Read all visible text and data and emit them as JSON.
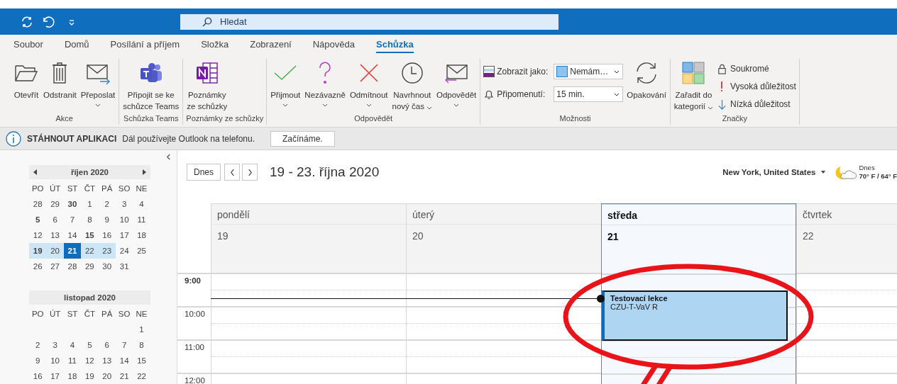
{
  "search": {
    "placeholder": "Hledat"
  },
  "tabs": [
    {
      "label": "Soubor",
      "selected": false
    },
    {
      "label": "Domů",
      "selected": false
    },
    {
      "label": "Posílání a příjem",
      "selected": false
    },
    {
      "label": "Složka",
      "selected": false
    },
    {
      "label": "Zobrazení",
      "selected": false
    },
    {
      "label": "Nápověda",
      "selected": false
    },
    {
      "label": "Schůzka",
      "selected": true
    }
  ],
  "ribbon": [
    {
      "label": "Akce",
      "items": [
        {
          "kind": "open",
          "lines": [
            "Otevřít"
          ],
          "dropdown": false
        },
        {
          "kind": "delete",
          "lines": [
            "Odstranit"
          ],
          "dropdown": false
        },
        {
          "kind": "forward",
          "lines": [
            "Přeposlat"
          ],
          "dropdown": true
        }
      ]
    },
    {
      "label": "Schůzka Teams",
      "items": [
        {
          "kind": "teams",
          "lines": [
            "Připojit se ke",
            "schůzce Teams"
          ],
          "dropdown": false
        }
      ]
    },
    {
      "label": "Poznámky ze schůzky",
      "items": [
        {
          "kind": "notes",
          "lines": [
            "Poznámky",
            "ze schůzky"
          ],
          "dropdown": false
        }
      ]
    },
    {
      "label": "Odpovědět",
      "items": [
        {
          "kind": "accept",
          "lines": [
            "Přijmout"
          ],
          "dropdown": true
        },
        {
          "kind": "tentative",
          "lines": [
            "Nezávazně"
          ],
          "dropdown": true
        },
        {
          "kind": "decline",
          "lines": [
            "Odmítnout"
          ],
          "dropdown": true
        },
        {
          "kind": "propose",
          "lines": [
            "Navrhnout",
            "nový čas"
          ],
          "dropdown": true
        },
        {
          "kind": "respond",
          "lines": [
            "Odpovědět"
          ],
          "dropdown": true
        }
      ]
    },
    {
      "label": "Možnosti",
      "items": [
        {
          "kind": "showas",
          "label": "Zobrazit jako:",
          "value": "Nemám…"
        },
        {
          "kind": "reminder",
          "label": "Připomenutí:",
          "value": "15 min."
        },
        {
          "kind": "recurrence",
          "lines": [
            "Opakování"
          ],
          "dropdown": false
        }
      ]
    },
    {
      "label": "Značky",
      "items": [
        {
          "kind": "categorize",
          "lines": [
            "Zařadit do",
            "kategorií"
          ],
          "dropdown": true
        },
        {
          "kind": "private",
          "label": "Soukromé"
        },
        {
          "kind": "high",
          "label": "Vysoká důležitost"
        },
        {
          "kind": "low",
          "label": "Nízká důležitost"
        }
      ]
    }
  ],
  "info_bar": {
    "title": "STÁHNOUT APLIKACI",
    "message": "Dál používejte Outlook na telefonu.",
    "button": "Začínáme."
  },
  "months": [
    {
      "title": "říjen 2020",
      "navigation": true,
      "weekdays": [
        "PO",
        "ÚT",
        "ST",
        "ČT",
        "PÁ",
        "SO",
        "NE"
      ],
      "weeks": [
        [
          {
            "d": "28",
            "bold": false,
            "selected": false,
            "today": false
          },
          {
            "d": "29",
            "bold": false,
            "selected": false,
            "today": false
          },
          {
            "d": "30",
            "bold": true,
            "selected": false,
            "today": false
          },
          {
            "d": "1",
            "bold": false,
            "selected": false,
            "today": false
          },
          {
            "d": "2",
            "bold": false,
            "selected": false,
            "today": false
          },
          {
            "d": "3",
            "bold": false,
            "selected": false,
            "today": false
          },
          {
            "d": "4",
            "bold": false,
            "selected": false,
            "today": false
          }
        ],
        [
          {
            "d": "5",
            "bold": true,
            "selected": false,
            "today": false
          },
          {
            "d": "6",
            "bold": false,
            "selected": false,
            "today": false
          },
          {
            "d": "7",
            "bold": false,
            "selected": false,
            "today": false
          },
          {
            "d": "8",
            "bold": false,
            "selected": false,
            "today": false
          },
          {
            "d": "9",
            "bold": false,
            "selected": false,
            "today": false
          },
          {
            "d": "10",
            "bold": false,
            "selected": false,
            "today": false
          },
          {
            "d": "11",
            "bold": false,
            "selected": false,
            "today": false
          }
        ],
        [
          {
            "d": "12",
            "bold": false,
            "selected": false,
            "today": false
          },
          {
            "d": "13",
            "bold": false,
            "selected": false,
            "today": false
          },
          {
            "d": "14",
            "bold": false,
            "selected": false,
            "today": false
          },
          {
            "d": "15",
            "bold": true,
            "selected": false,
            "today": false
          },
          {
            "d": "16",
            "bold": false,
            "selected": false,
            "today": false
          },
          {
            "d": "17",
            "bold": false,
            "selected": false,
            "today": false
          },
          {
            "d": "18",
            "bold": false,
            "selected": false,
            "today": false
          }
        ],
        [
          {
            "d": "19",
            "bold": true,
            "selected": true,
            "today": false
          },
          {
            "d": "20",
            "bold": false,
            "selected": true,
            "today": false
          },
          {
            "d": "21",
            "bold": true,
            "selected": true,
            "today": true
          },
          {
            "d": "22",
            "bold": false,
            "selected": true,
            "today": false
          },
          {
            "d": "23",
            "bold": false,
            "selected": true,
            "today": false
          },
          {
            "d": "24",
            "bold": false,
            "selected": false,
            "today": false
          },
          {
            "d": "25",
            "bold": false,
            "selected": false,
            "today": false
          }
        ],
        [
          {
            "d": "26",
            "bold": false,
            "selected": false,
            "today": false
          },
          {
            "d": "27",
            "bold": false,
            "selected": false,
            "today": false
          },
          {
            "d": "28",
            "bold": false,
            "selected": false,
            "today": false
          },
          {
            "d": "29",
            "bold": false,
            "selected": false,
            "today": false
          },
          {
            "d": "30",
            "bold": false,
            "selected": false,
            "today": false
          },
          {
            "d": "31",
            "bold": false,
            "selected": false,
            "today": false
          }
        ]
      ]
    },
    {
      "title": "listopad 2020",
      "navigation": false,
      "weekdays": [
        "PO",
        "ÚT",
        "ST",
        "ČT",
        "PÁ",
        "SO",
        "NE"
      ],
      "weeks": [
        [
          {
            "d": "1",
            "bold": false,
            "selected": false,
            "today": false
          }
        ],
        [
          {
            "d": "2",
            "bold": false,
            "selected": false,
            "today": false
          },
          {
            "d": "3",
            "bold": false,
            "selected": false,
            "today": false
          },
          {
            "d": "4",
            "bold": false,
            "selected": false,
            "today": false
          },
          {
            "d": "5",
            "bold": false,
            "selected": false,
            "today": false
          },
          {
            "d": "6",
            "bold": false,
            "selected": false,
            "today": false
          },
          {
            "d": "7",
            "bold": false,
            "selected": false,
            "today": false
          },
          {
            "d": "8",
            "bold": false,
            "selected": false,
            "today": false
          }
        ],
        [
          {
            "d": "9",
            "bold": false,
            "selected": false,
            "today": false
          },
          {
            "d": "10",
            "bold": false,
            "selected": false,
            "today": false
          },
          {
            "d": "11",
            "bold": false,
            "selected": false,
            "today": false
          },
          {
            "d": "12",
            "bold": false,
            "selected": false,
            "today": false
          },
          {
            "d": "13",
            "bold": false,
            "selected": false,
            "today": false
          },
          {
            "d": "14",
            "bold": false,
            "selected": false,
            "today": false
          },
          {
            "d": "15",
            "bold": false,
            "selected": false,
            "today": false
          }
        ],
        [
          {
            "d": "16",
            "bold": false,
            "selected": false,
            "today": false
          },
          {
            "d": "17",
            "bold": false,
            "selected": false,
            "today": false
          },
          {
            "d": "18",
            "bold": false,
            "selected": false,
            "today": false
          },
          {
            "d": "19",
            "bold": false,
            "selected": false,
            "today": false
          },
          {
            "d": "20",
            "bold": false,
            "selected": false,
            "today": false
          },
          {
            "d": "21",
            "bold": false,
            "selected": false,
            "today": false
          },
          {
            "d": "22",
            "bold": false,
            "selected": false,
            "today": false
          }
        ]
      ]
    }
  ],
  "calendar": {
    "today_button": "Dnes",
    "title": "19 - 23. října 2020",
    "location": "New York, United States",
    "weather": {
      "label": "Dnes",
      "temperature": "70° F / 64° F"
    },
    "days": [
      {
        "name": "pondělí",
        "date": "19",
        "selected": false
      },
      {
        "name": "úterý",
        "date": "20",
        "selected": false
      },
      {
        "name": "středa",
        "date": "21",
        "selected": true,
        "events": [
          {
            "title": "Testovací lekce",
            "location": "CZU-T-VaV R",
            "selected": true
          }
        ]
      },
      {
        "name": "čtvrtek",
        "date": "22",
        "selected": false
      }
    ],
    "times": [
      {
        "label": "9:00",
        "current": true
      },
      {
        "label": "10:00",
        "current": false
      },
      {
        "label": "11:00",
        "current": false
      },
      {
        "label": "12:00",
        "current": false
      }
    ]
  }
}
